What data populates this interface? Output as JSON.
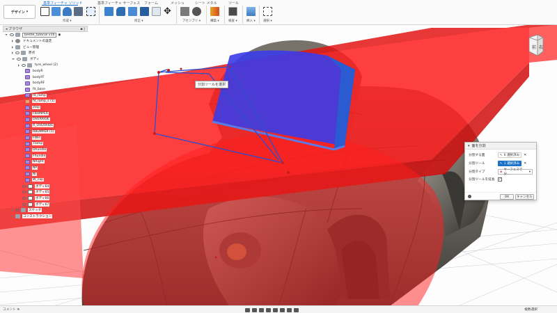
{
  "workspace": {
    "label": "デザイン"
  },
  "tabs": [
    {
      "label": "基準フィーチャ ソリッド",
      "active": true
    },
    {
      "label": "基準フィーチャ サーフェス",
      "active": false
    },
    {
      "label": "フォーム",
      "active": false
    },
    {
      "label": "メッシュ",
      "active": false
    },
    {
      "label": "シート メタル",
      "active": false
    },
    {
      "label": "ツール",
      "active": false
    }
  ],
  "tool_groups": [
    "作成",
    "修正",
    "アセンブリ",
    "構築",
    "検査",
    "挿入",
    "選択"
  ],
  "browser": {
    "title": "ブラウザ",
    "root": "beetle_tutorial v16",
    "nodes": [
      {
        "label": "ドキュメントの設定",
        "icon": "gear-icon"
      },
      {
        "label": "ビュー管理",
        "icon": "folder-icon"
      },
      {
        "label": "原点",
        "icon": "folder-icon"
      },
      {
        "label": "ボディ",
        "icon": "folder-icon"
      }
    ],
    "bodies": [
      "tyre_wheel (2)",
      "bodyR",
      "bodyFF",
      "bodyRF",
      "fd_base",
      "fd_ramp",
      "fd_ramp_s (1)",
      "step",
      "FBUMPER",
      "OVERRIDE",
      "R_OVERRIDE",
      "RBUMPER (1)",
      "FWin",
      "Tlamp",
      "Dhundle",
      "Fhundle",
      "NRight",
      "NP",
      "NI",
      "W_cap"
    ],
    "body_groups": [
      "ボディ64",
      "ボディ65",
      "ボディ66",
      "ボディ67"
    ],
    "tail": [
      "スケッチ",
      "コンストラクション"
    ]
  },
  "tooltip": "分割ツールを選択",
  "dialog": {
    "title": "面を分割",
    "faces_label": "分割する面",
    "faces_value": "6 選択済み",
    "tool_label": "分割ツール",
    "tool_value": "1 選択済み",
    "type_label": "分割タイプ",
    "type_value": "サーフェスで分...",
    "extend_label": "分割ツールを延長",
    "extend_checked": true,
    "ok": "OK",
    "cancel": "キャンセル"
  },
  "viewcube": {
    "face": "前",
    "side": "右"
  },
  "status": {
    "comment": "コメント",
    "right": "複数選択"
  },
  "colors": {
    "accent": "#1a6ec2",
    "split_tool": "#ff0000",
    "selected_face": "#3a3af0",
    "body": "#6e6a62"
  }
}
